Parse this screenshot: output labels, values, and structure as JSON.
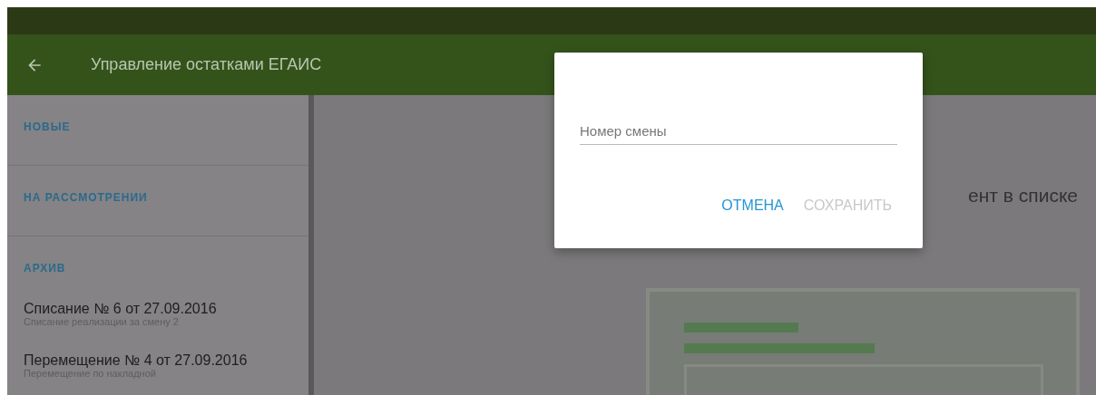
{
  "app_bar": {
    "title": "Управление остатками ЕГАИС"
  },
  "sidebar": {
    "sections": [
      {
        "header": "НОВЫЕ"
      },
      {
        "header": "НА РАССМОТРЕНИИ"
      },
      {
        "header": "АРХИВ",
        "items": [
          {
            "title": "Списание № 6 от 27.09.2016",
            "subtitle": "Списание реализации за смену 2"
          },
          {
            "title": "Перемещение № 4 от 27.09.2016",
            "subtitle": "Перемещение по накладной"
          }
        ]
      }
    ]
  },
  "main": {
    "message": "ент в списке"
  },
  "dialog": {
    "field": {
      "placeholder": "Номер смены"
    },
    "buttons": [
      {
        "label": "ОТМЕНА",
        "disabled": false
      },
      {
        "label": "СОХРАНИТЬ",
        "disabled": true
      }
    ]
  }
}
